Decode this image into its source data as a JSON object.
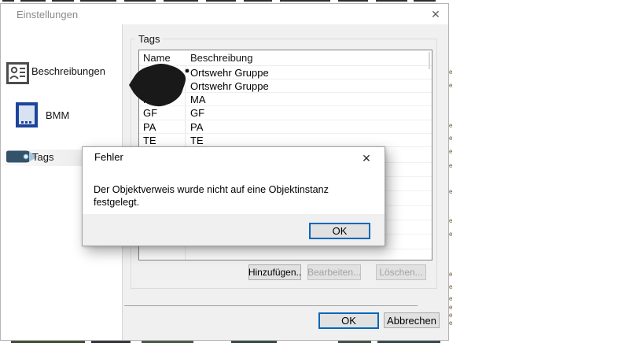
{
  "window": {
    "title": "Einstellungen",
    "close_glyph": "✕"
  },
  "sidebar": {
    "items": [
      {
        "id": "beschreibungen",
        "label": "Beschreibungen",
        "icon": "contact-card-icon",
        "selected": false
      },
      {
        "id": "bmm",
        "label": "BMM",
        "icon": "mobile-device-icon",
        "selected": false
      },
      {
        "id": "tags",
        "label": "Tags",
        "icon": "tag-icon",
        "selected": true
      }
    ]
  },
  "panel": {
    "group_title": "Tags",
    "table": {
      "columns": [
        "Name",
        "Beschreibung"
      ],
      "rows": [
        {
          "name": "",
          "beschreibung": "Ortswehr Gruppe",
          "redacted": true
        },
        {
          "name": "",
          "beschreibung": "Ortswehr Gruppe",
          "redacted": true
        },
        {
          "name": "MA",
          "beschreibung": "MA",
          "redacted": false
        },
        {
          "name": "GF",
          "beschreibung": "GF",
          "redacted": false
        },
        {
          "name": "PA",
          "beschreibung": "PA",
          "redacted": false
        },
        {
          "name": "TE",
          "beschreibung": "TE",
          "redacted": false
        }
      ]
    },
    "actions": {
      "add": "Hinzufügen..",
      "edit": "Bearbeiten...",
      "delete": "Löschen...",
      "edit_enabled": false,
      "delete_enabled": false
    }
  },
  "footer": {
    "ok": "OK",
    "cancel": "Abbrechen"
  },
  "error_dialog": {
    "title": "Fehler",
    "message": "Der Objektverweis wurde nicht auf eine Objektinstanz festgelegt.",
    "ok": "OK",
    "close_glyph": "✕"
  },
  "colors": {
    "accent": "#0067b8",
    "dialog_bg": "#f0f0f0",
    "button_bg": "#e1e1e1",
    "titlebar_text": "#8a8a8a"
  },
  "artifacts": {
    "top_segments": [
      [
        3,
        18
      ],
      [
        26,
        58
      ],
      [
        66,
        94
      ],
      [
        102,
        148
      ],
      [
        158,
        198
      ],
      [
        208,
        252
      ],
      [
        262,
        300
      ],
      [
        310,
        346
      ],
      [
        356,
        420
      ],
      [
        430,
        468
      ],
      [
        478,
        518
      ],
      [
        526,
        554
      ]
    ],
    "bottom_segments": [
      [
        14,
        108
      ],
      [
        116,
        166
      ],
      [
        180,
        246
      ],
      [
        294,
        352
      ],
      [
        430,
        472
      ],
      [
        480,
        560
      ]
    ],
    "bottom_colors": [
      "#47543f",
      "#3c3c44",
      "#52604d",
      "#3f5147",
      "#49574d",
      "#3e4e56"
    ],
    "right_speck_ys": [
      88,
      105,
      156,
      172,
      189,
      207,
      240,
      277,
      294,
      345,
      361,
      376,
      387,
      397,
      407
    ]
  }
}
